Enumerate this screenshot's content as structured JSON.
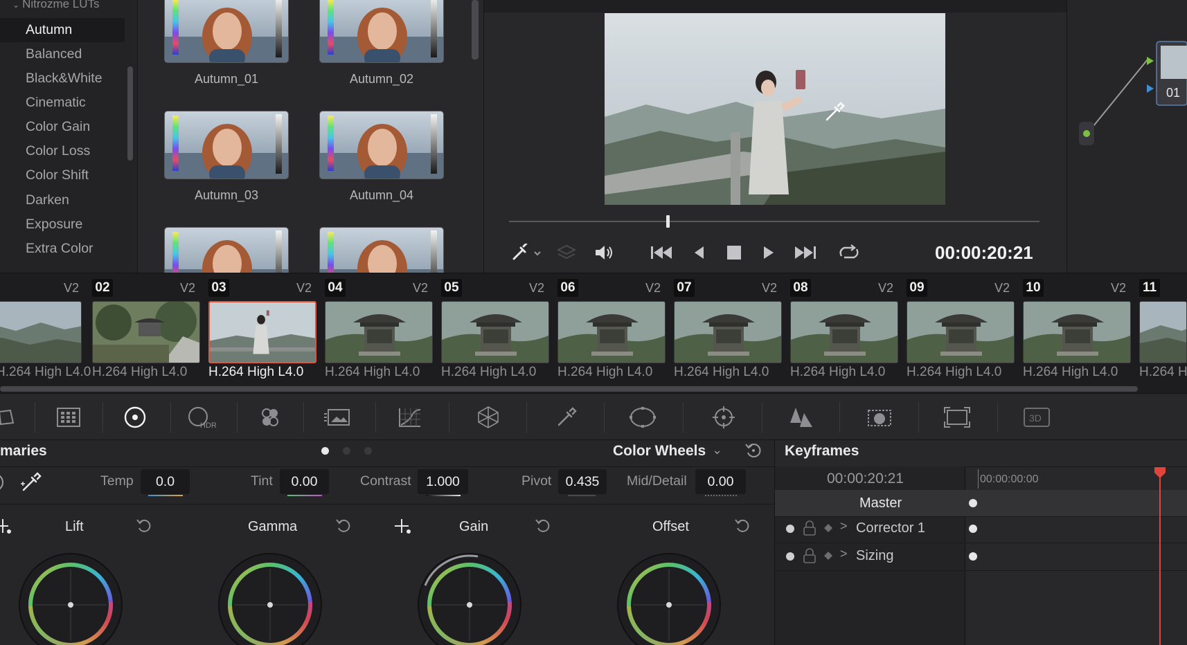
{
  "lut_browser": {
    "folder": "Nitrozme LUTs",
    "items": [
      {
        "label": "Autumn",
        "selected": true
      },
      {
        "label": "Balanced"
      },
      {
        "label": "Black&White"
      },
      {
        "label": "Cinematic"
      },
      {
        "label": "Color Gain"
      },
      {
        "label": "Color Loss"
      },
      {
        "label": "Color Shift"
      },
      {
        "label": "Darken"
      },
      {
        "label": "Exposure"
      },
      {
        "label": "Extra Color"
      }
    ],
    "thumbnails": [
      {
        "label": "Autumn_01"
      },
      {
        "label": "Autumn_02"
      },
      {
        "label": "Autumn_03"
      },
      {
        "label": "Autumn_04"
      },
      {
        "label": ""
      },
      {
        "label": ""
      }
    ]
  },
  "viewer": {
    "timecode": "00:00:20:21",
    "scrub_position": 0.3
  },
  "nodes": {
    "node_label": "01"
  },
  "clips": {
    "items": [
      {
        "num": "",
        "track": "V2",
        "codec": "H.264 High L4.0"
      },
      {
        "num": "02",
        "track": "V2",
        "codec": "H.264 High L4.0"
      },
      {
        "num": "03",
        "track": "V2",
        "codec": "H.264 High L4.0",
        "selected": true
      },
      {
        "num": "04",
        "track": "V2",
        "codec": "H.264 High L4.0"
      },
      {
        "num": "05",
        "track": "V2",
        "codec": "H.264 High L4.0"
      },
      {
        "num": "06",
        "track": "V2",
        "codec": "H.264 High L4.0"
      },
      {
        "num": "07",
        "track": "V2",
        "codec": "H.264 High L4.0"
      },
      {
        "num": "08",
        "track": "V2",
        "codec": "H.264 High L4.0"
      },
      {
        "num": "09",
        "track": "V2",
        "codec": "H.264 High L4.0"
      },
      {
        "num": "10",
        "track": "V2",
        "codec": "H.264 High L4.0"
      },
      {
        "num": "11",
        "track": "",
        "codec": "H.264 H"
      }
    ]
  },
  "palette": {
    "hdr_label": "HDR",
    "threed_label": "3D"
  },
  "primaries": {
    "title": "maries",
    "mode": "Color Wheels",
    "adjustments": {
      "temp_label": "Temp",
      "temp_value": "0.0",
      "tint_label": "Tint",
      "tint_value": "0.00",
      "contrast_label": "Contrast",
      "contrast_value": "1.000",
      "pivot_label": "Pivot",
      "pivot_value": "0.435",
      "middetail_label": "Mid/Detail",
      "middetail_value": "0.00"
    },
    "wheels": {
      "lift": "Lift",
      "gamma": "Gamma",
      "gain": "Gain",
      "offset": "Offset"
    }
  },
  "keyframes": {
    "title": "Keyframes",
    "current_timecode": "00:00:20:21",
    "ruler_start": "00:00:00:00",
    "master_label": "Master",
    "rows": [
      {
        "label": "Corrector 1"
      },
      {
        "label": "Sizing"
      }
    ]
  },
  "colors": {
    "accent_selection": "#e0563d",
    "playhead": "#e0443a",
    "node_green": "#7bc043",
    "node_blue": "#3d8fd6"
  }
}
